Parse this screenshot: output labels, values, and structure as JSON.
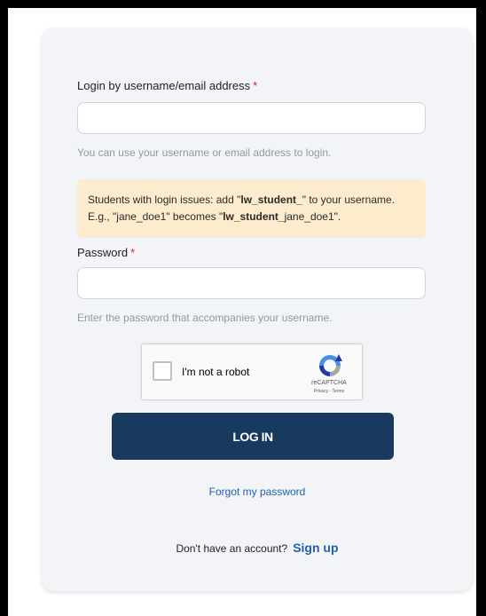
{
  "login": {
    "username_label": "Login by username/email address",
    "required_marker": "*",
    "username_value": "",
    "username_hint": "You can use your username or email address to login.",
    "notice": {
      "line1_prefix": "Students with login issues: add \"",
      "line1_bold": "lw_student_",
      "line1_suffix": "\" to your username.",
      "line2_prefix": "E.g., \"jane_doe1\" becomes \"",
      "line2_bold": "lw_student_",
      "line2_suffix": "jane_doe1\"."
    },
    "password_label": "Password",
    "password_value": "",
    "password_hint": "Enter the password that accompanies your username.",
    "captcha": {
      "label": "I'm not a robot",
      "brand": "reCAPTCHA",
      "links": "Privacy - Terms"
    },
    "login_button": "LOG IN",
    "forgot_link": "Forgot my password",
    "signup_prompt": "Don't have an account?",
    "signup_link": "Sign up"
  },
  "colors": {
    "primary": "#173a5e",
    "link": "#2162a8",
    "required": "#d6262b",
    "notice_bg": "#fdebcd",
    "card_bg": "#f2f4f7"
  }
}
